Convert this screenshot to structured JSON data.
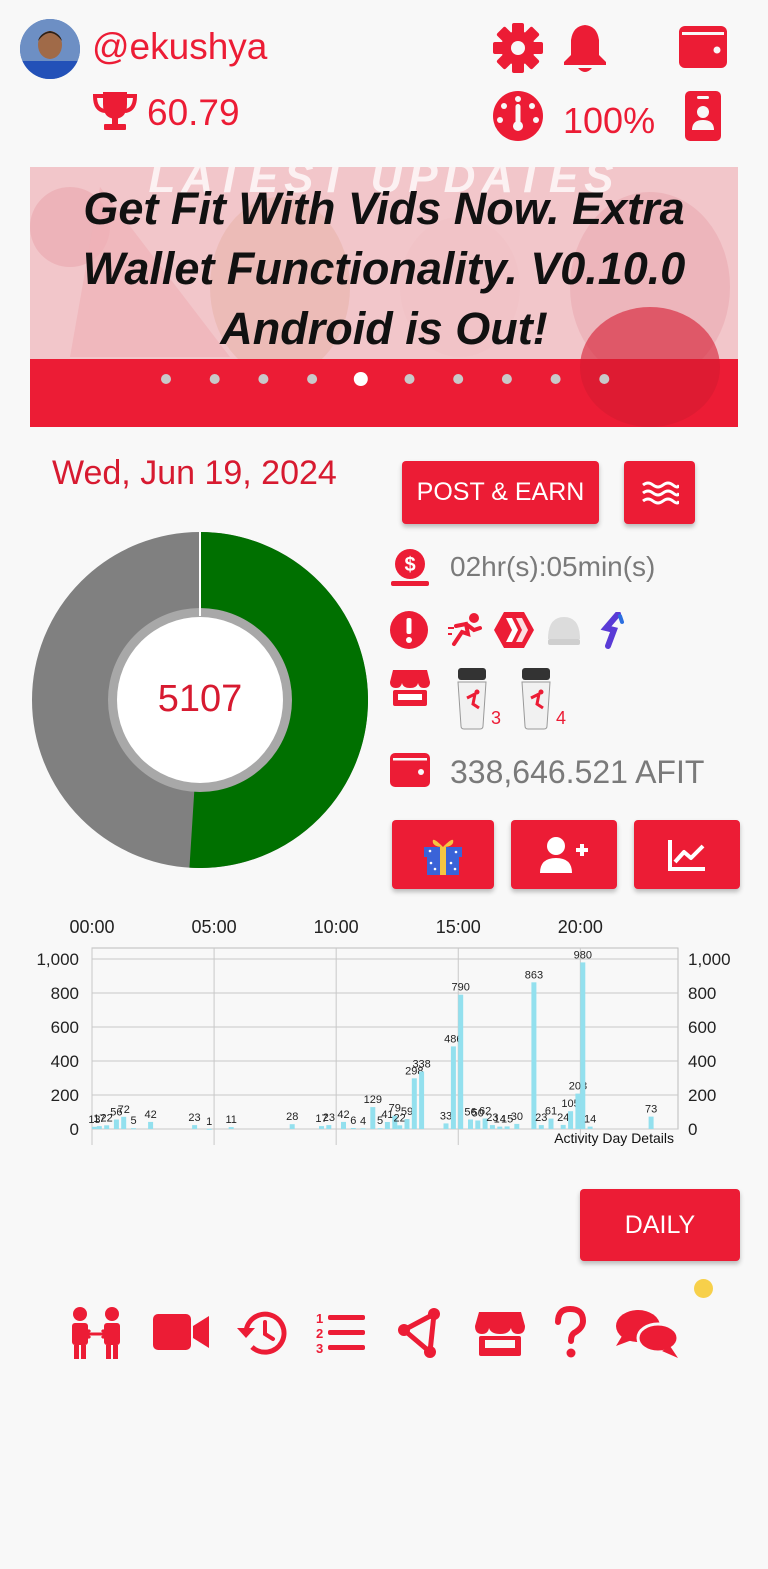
{
  "header": {
    "username": "@ekushya",
    "score": "60.79",
    "battery": "100%"
  },
  "banner": {
    "subtitle": "LATEST UPDATES",
    "headline": "Get Fit With Vids Now. Extra Wallet Functionality. V0.10.0 Android is Out!",
    "slide_count": 10,
    "active_slide": 5
  },
  "date": "Wed, Jun 19, 2024",
  "post_earn_label": "POST & EARN",
  "steps": {
    "total": "5107",
    "progress_fraction": 0.51,
    "progress_color": "#007000",
    "remaining_color": "#808080"
  },
  "stats": {
    "time": "02hr(s):05min(s)",
    "item1_count": "3",
    "item2_count": "4",
    "balance": "338,646.521 AFIT"
  },
  "chart_data": {
    "type": "bar",
    "title": "",
    "x_top_ticks": [
      "00:00",
      "05:00",
      "10:00",
      "15:00",
      "20:00"
    ],
    "y_ticks": [
      "1,000",
      "800",
      "600",
      "400",
      "200",
      "0"
    ],
    "ylim": [
      0,
      1000
    ],
    "xlim": [
      0,
      24
    ],
    "legend_label": "Activity Day Details",
    "bar_color": "#93e0ee",
    "bars": [
      {
        "x": 0.1,
        "v": 13,
        "label": "13"
      },
      {
        "x": 0.3,
        "v": 17,
        "label": "17"
      },
      {
        "x": 0.6,
        "v": 22,
        "label": "22"
      },
      {
        "x": 1.0,
        "v": 56,
        "label": "56"
      },
      {
        "x": 1.3,
        "v": 72,
        "label": "72"
      },
      {
        "x": 1.7,
        "v": 5,
        "label": "5"
      },
      {
        "x": 2.4,
        "v": 42,
        "label": "42"
      },
      {
        "x": 4.2,
        "v": 23,
        "label": "23"
      },
      {
        "x": 4.8,
        "v": 1,
        "label": "1"
      },
      {
        "x": 5.7,
        "v": 11,
        "label": "11"
      },
      {
        "x": 8.2,
        "v": 28,
        "label": "28"
      },
      {
        "x": 9.4,
        "v": 17,
        "label": "17"
      },
      {
        "x": 9.7,
        "v": 23,
        "label": "23"
      },
      {
        "x": 10.3,
        "v": 42,
        "label": "42"
      },
      {
        "x": 10.7,
        "v": 6,
        "label": "6"
      },
      {
        "x": 11.1,
        "v": 4,
        "label": "4"
      },
      {
        "x": 11.5,
        "v": 129,
        "label": "129"
      },
      {
        "x": 11.8,
        "v": 5,
        "label": "5"
      },
      {
        "x": 12.1,
        "v": 41,
        "label": "41"
      },
      {
        "x": 12.4,
        "v": 79,
        "label": "79"
      },
      {
        "x": 12.6,
        "v": 22,
        "label": "22"
      },
      {
        "x": 12.9,
        "v": 59,
        "label": "59"
      },
      {
        "x": 13.2,
        "v": 298,
        "label": "298"
      },
      {
        "x": 13.5,
        "v": 338,
        "label": "338"
      },
      {
        "x": 14.5,
        "v": 33,
        "label": "33"
      },
      {
        "x": 14.8,
        "v": 486,
        "label": "486"
      },
      {
        "x": 15.1,
        "v": 790,
        "label": "790"
      },
      {
        "x": 15.5,
        "v": 56,
        "label": "56"
      },
      {
        "x": 15.8,
        "v": 50,
        "label": "50"
      },
      {
        "x": 16.1,
        "v": 62,
        "label": "62"
      },
      {
        "x": 16.4,
        "v": 23,
        "label": "23"
      },
      {
        "x": 16.7,
        "v": 14,
        "label": "14"
      },
      {
        "x": 17.0,
        "v": 15,
        "label": "15"
      },
      {
        "x": 17.4,
        "v": 30,
        "label": "30"
      },
      {
        "x": 18.1,
        "v": 863,
        "label": "863"
      },
      {
        "x": 18.4,
        "v": 23,
        "label": "23"
      },
      {
        "x": 18.8,
        "v": 61,
        "label": "61"
      },
      {
        "x": 19.3,
        "v": 24,
        "label": "24"
      },
      {
        "x": 19.6,
        "v": 105,
        "label": "105"
      },
      {
        "x": 19.9,
        "v": 208,
        "label": "208"
      },
      {
        "x": 20.1,
        "v": 980,
        "label": "980"
      },
      {
        "x": 20.4,
        "v": 14,
        "label": "14"
      },
      {
        "x": 22.9,
        "v": 73,
        "label": "73"
      }
    ]
  },
  "daily_label": "DAILY",
  "icons": {
    "settings": "gear-icon",
    "notifications": "bell-icon",
    "wallet": "wallet-icon",
    "speed": "speedometer-icon",
    "profile": "id-badge-icon",
    "trophy": "trophy-icon"
  }
}
